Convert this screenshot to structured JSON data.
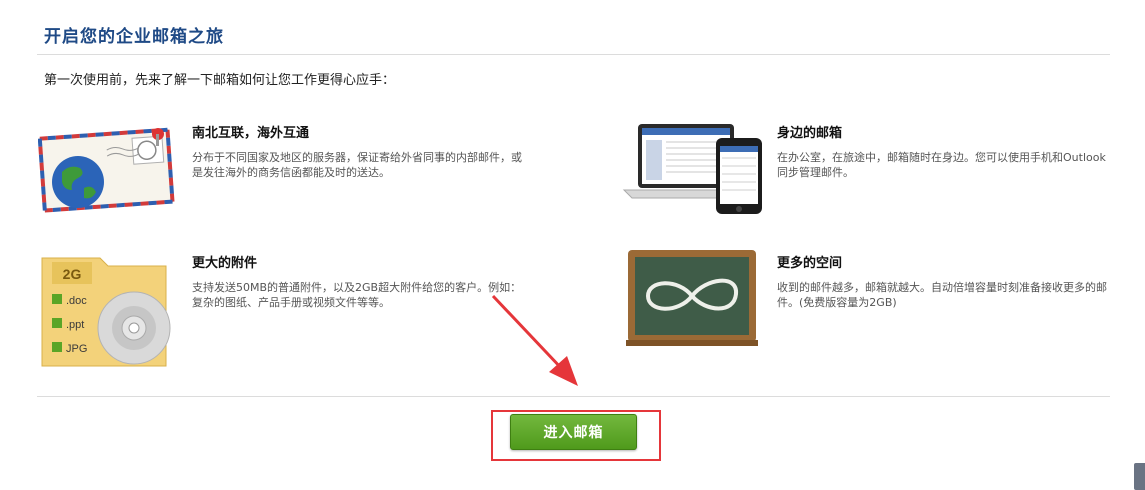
{
  "page": {
    "title": "开启您的企业邮箱之旅",
    "intro": "第一次使用前，先来了解一下邮箱如何让您工作更得心应手："
  },
  "features": [
    {
      "title": "南北互联，海外互通",
      "desc": "分布于不同国家及地区的服务器，保证寄给外省同事的内部邮件，或是发往海外的商务信函都能及时的送达。",
      "icon": "globe-envelope-icon"
    },
    {
      "title": "身边的邮箱",
      "desc": "在办公室，在旅途中，邮箱随时在身边。您可以使用手机和Outlook同步管理邮件。",
      "icon": "laptop-phone-icon"
    },
    {
      "title": "更大的附件",
      "desc": "支持发送50MB的普通附件，以及2GB超大附件给您的客户。例如：复杂的图纸、产品手册或视频文件等等。",
      "icon": "attachment-folder-icon"
    },
    {
      "title": "更多的空间",
      "desc": "收到的邮件越多，邮箱就越大。自动倍增容量时刻准备接收更多的邮件。(免费版容量为2GB)",
      "icon": "chalkboard-infinity-icon"
    }
  ],
  "folder": {
    "size_label": "2G",
    "files": [
      ".doc",
      ".ppt",
      "JPG"
    ]
  },
  "action": {
    "enter_label": "进入邮箱"
  },
  "colors": {
    "title": "#1f4a86",
    "button": "#5aa526",
    "highlight": "#e5363a",
    "arrow": "#e5363a"
  }
}
